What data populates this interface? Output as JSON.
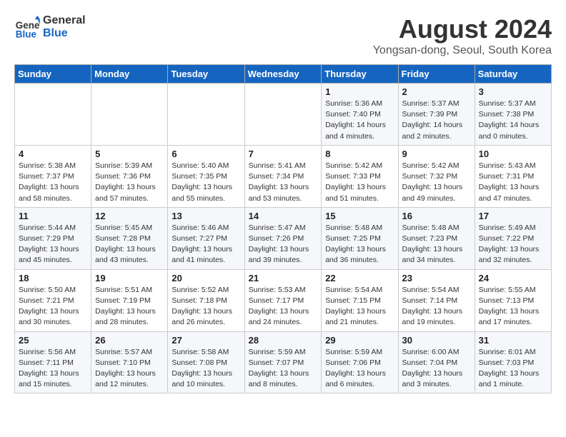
{
  "header": {
    "logo_line1": "General",
    "logo_line2": "Blue",
    "month_year": "August 2024",
    "location": "Yongsan-dong, Seoul, South Korea"
  },
  "weekdays": [
    "Sunday",
    "Monday",
    "Tuesday",
    "Wednesday",
    "Thursday",
    "Friday",
    "Saturday"
  ],
  "weeks": [
    [
      {
        "day": "",
        "info": ""
      },
      {
        "day": "",
        "info": ""
      },
      {
        "day": "",
        "info": ""
      },
      {
        "day": "",
        "info": ""
      },
      {
        "day": "1",
        "info": "Sunrise: 5:36 AM\nSunset: 7:40 PM\nDaylight: 14 hours\nand 4 minutes."
      },
      {
        "day": "2",
        "info": "Sunrise: 5:37 AM\nSunset: 7:39 PM\nDaylight: 14 hours\nand 2 minutes."
      },
      {
        "day": "3",
        "info": "Sunrise: 5:37 AM\nSunset: 7:38 PM\nDaylight: 14 hours\nand 0 minutes."
      }
    ],
    [
      {
        "day": "4",
        "info": "Sunrise: 5:38 AM\nSunset: 7:37 PM\nDaylight: 13 hours\nand 58 minutes."
      },
      {
        "day": "5",
        "info": "Sunrise: 5:39 AM\nSunset: 7:36 PM\nDaylight: 13 hours\nand 57 minutes."
      },
      {
        "day": "6",
        "info": "Sunrise: 5:40 AM\nSunset: 7:35 PM\nDaylight: 13 hours\nand 55 minutes."
      },
      {
        "day": "7",
        "info": "Sunrise: 5:41 AM\nSunset: 7:34 PM\nDaylight: 13 hours\nand 53 minutes."
      },
      {
        "day": "8",
        "info": "Sunrise: 5:42 AM\nSunset: 7:33 PM\nDaylight: 13 hours\nand 51 minutes."
      },
      {
        "day": "9",
        "info": "Sunrise: 5:42 AM\nSunset: 7:32 PM\nDaylight: 13 hours\nand 49 minutes."
      },
      {
        "day": "10",
        "info": "Sunrise: 5:43 AM\nSunset: 7:31 PM\nDaylight: 13 hours\nand 47 minutes."
      }
    ],
    [
      {
        "day": "11",
        "info": "Sunrise: 5:44 AM\nSunset: 7:29 PM\nDaylight: 13 hours\nand 45 minutes."
      },
      {
        "day": "12",
        "info": "Sunrise: 5:45 AM\nSunset: 7:28 PM\nDaylight: 13 hours\nand 43 minutes."
      },
      {
        "day": "13",
        "info": "Sunrise: 5:46 AM\nSunset: 7:27 PM\nDaylight: 13 hours\nand 41 minutes."
      },
      {
        "day": "14",
        "info": "Sunrise: 5:47 AM\nSunset: 7:26 PM\nDaylight: 13 hours\nand 39 minutes."
      },
      {
        "day": "15",
        "info": "Sunrise: 5:48 AM\nSunset: 7:25 PM\nDaylight: 13 hours\nand 36 minutes."
      },
      {
        "day": "16",
        "info": "Sunrise: 5:48 AM\nSunset: 7:23 PM\nDaylight: 13 hours\nand 34 minutes."
      },
      {
        "day": "17",
        "info": "Sunrise: 5:49 AM\nSunset: 7:22 PM\nDaylight: 13 hours\nand 32 minutes."
      }
    ],
    [
      {
        "day": "18",
        "info": "Sunrise: 5:50 AM\nSunset: 7:21 PM\nDaylight: 13 hours\nand 30 minutes."
      },
      {
        "day": "19",
        "info": "Sunrise: 5:51 AM\nSunset: 7:19 PM\nDaylight: 13 hours\nand 28 minutes."
      },
      {
        "day": "20",
        "info": "Sunrise: 5:52 AM\nSunset: 7:18 PM\nDaylight: 13 hours\nand 26 minutes."
      },
      {
        "day": "21",
        "info": "Sunrise: 5:53 AM\nSunset: 7:17 PM\nDaylight: 13 hours\nand 24 minutes."
      },
      {
        "day": "22",
        "info": "Sunrise: 5:54 AM\nSunset: 7:15 PM\nDaylight: 13 hours\nand 21 minutes."
      },
      {
        "day": "23",
        "info": "Sunrise: 5:54 AM\nSunset: 7:14 PM\nDaylight: 13 hours\nand 19 minutes."
      },
      {
        "day": "24",
        "info": "Sunrise: 5:55 AM\nSunset: 7:13 PM\nDaylight: 13 hours\nand 17 minutes."
      }
    ],
    [
      {
        "day": "25",
        "info": "Sunrise: 5:56 AM\nSunset: 7:11 PM\nDaylight: 13 hours\nand 15 minutes."
      },
      {
        "day": "26",
        "info": "Sunrise: 5:57 AM\nSunset: 7:10 PM\nDaylight: 13 hours\nand 12 minutes."
      },
      {
        "day": "27",
        "info": "Sunrise: 5:58 AM\nSunset: 7:08 PM\nDaylight: 13 hours\nand 10 minutes."
      },
      {
        "day": "28",
        "info": "Sunrise: 5:59 AM\nSunset: 7:07 PM\nDaylight: 13 hours\nand 8 minutes."
      },
      {
        "day": "29",
        "info": "Sunrise: 5:59 AM\nSunset: 7:06 PM\nDaylight: 13 hours\nand 6 minutes."
      },
      {
        "day": "30",
        "info": "Sunrise: 6:00 AM\nSunset: 7:04 PM\nDaylight: 13 hours\nand 3 minutes."
      },
      {
        "day": "31",
        "info": "Sunrise: 6:01 AM\nSunset: 7:03 PM\nDaylight: 13 hours\nand 1 minute."
      }
    ]
  ]
}
